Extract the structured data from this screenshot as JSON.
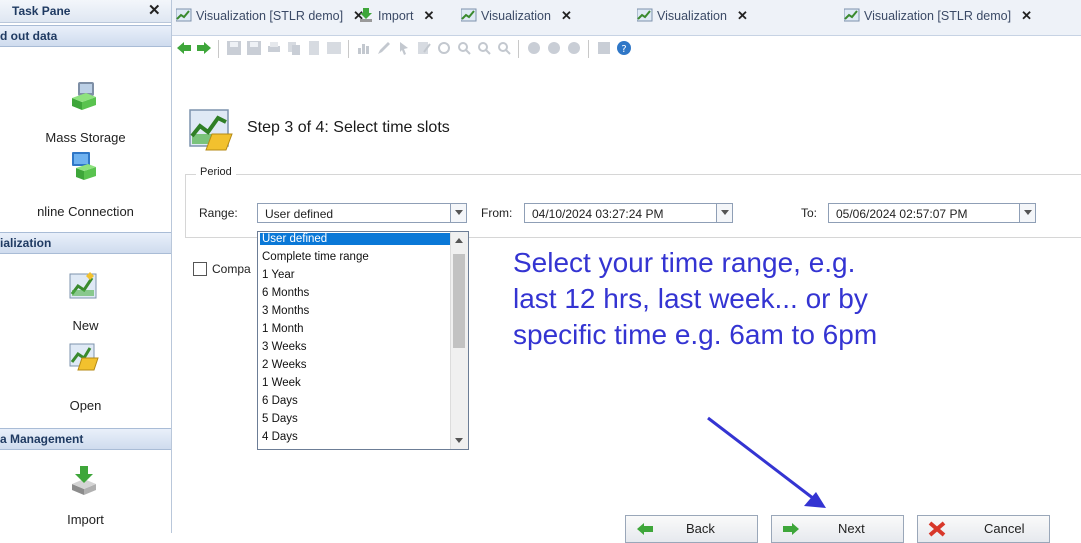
{
  "task_pane": {
    "title": "Task Pane",
    "close_glyph": "✕",
    "sections": [
      {
        "label": "d out data"
      },
      {
        "label": "ialization"
      },
      {
        "label": "a Management"
      }
    ],
    "items": [
      {
        "label": "Mass Storage",
        "icon": "mass-storage-icon"
      },
      {
        "label": "nline Connection",
        "icon": "online-connection-icon"
      },
      {
        "label": "New",
        "icon": "new-visualization-icon"
      },
      {
        "label": "Open",
        "icon": "open-visualization-icon"
      },
      {
        "label": "Import",
        "icon": "import-icon"
      }
    ]
  },
  "tabs": [
    {
      "label": "Visualization [STLR demo]",
      "close": "✕",
      "icon": "chart-icon"
    },
    {
      "label": "Import",
      "close": "✕",
      "icon": "import-icon"
    },
    {
      "label": "Visualization",
      "close": "✕",
      "icon": "chart-icon"
    },
    {
      "label": "Visualization",
      "close": "✕",
      "icon": "chart-icon"
    },
    {
      "label": "Visualization [STLR demo]",
      "close": "✕",
      "icon": "chart-icon",
      "active": true
    }
  ],
  "wizard": {
    "step_title": "Step 3 of 4: Select time slots",
    "period_label": "Period",
    "range_label": "Range:",
    "range_value": "User defined",
    "from_label": "From:",
    "from_value": "04/10/2024 03:27:24 PM",
    "to_label": "To:",
    "to_value": "05/06/2024 02:57:07 PM",
    "compare_label": "Compa",
    "range_options": [
      "User defined",
      "Complete time range",
      "1 Year",
      "6 Months",
      "3 Months",
      "1 Month",
      "3 Weeks",
      "2 Weeks",
      "1 Week",
      "6 Days",
      "5 Days",
      "4 Days"
    ],
    "selected_option_index": 0
  },
  "annotation": {
    "lines": [
      "Select your time range, e.g.",
      "last 12 hrs, last week... or by",
      "specific time e.g. 6am to 6pm"
    ],
    "color": "#3434d2"
  },
  "buttons": {
    "back": "Back",
    "next": "Next",
    "cancel": "Cancel"
  },
  "colors": {
    "accent": "#0a78d7",
    "pane_header": "#1f3a62"
  }
}
